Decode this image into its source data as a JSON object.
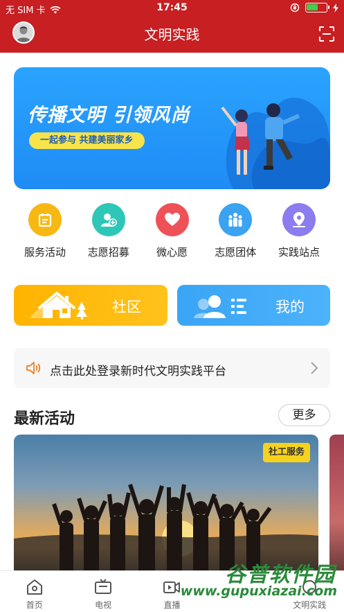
{
  "status": {
    "carrier": "无 SIM 卡",
    "time": "17:45",
    "battery_level": 0.6
  },
  "header": {
    "title": "文明实践"
  },
  "banner": {
    "title": "传播文明 引领风尚",
    "subtitle": "一起参与 共建美丽家乡"
  },
  "quick_actions": [
    {
      "label": "服务活动",
      "icon": "calendar-icon",
      "color": "#f8b814"
    },
    {
      "label": "志愿招募",
      "icon": "user-plus-icon",
      "color": "#2ec7b7"
    },
    {
      "label": "微心愿",
      "icon": "heart-icon",
      "color": "#ee5158"
    },
    {
      "label": "志愿团体",
      "icon": "group-icon",
      "color": "#3aa3f2"
    },
    {
      "label": "实践站点",
      "icon": "location-pin-icon",
      "color": "#8b7cf0"
    }
  ],
  "cards": {
    "community": "社区",
    "mine": "我的"
  },
  "notice": {
    "text": "点击此处登录新时代文明实践平台"
  },
  "latest": {
    "title": "最新活动",
    "more": "更多",
    "badge": "社工服务"
  },
  "tabs": [
    {
      "label": "首页",
      "icon": "home-icon"
    },
    {
      "label": "电视",
      "icon": "tv-icon"
    },
    {
      "label": "直播",
      "icon": "video-icon"
    },
    {
      "label": "",
      "icon": "blank"
    },
    {
      "label": "文明实践",
      "icon": "practice-icon"
    }
  ],
  "watermark": {
    "main": "谷普软件园",
    "url": "www.gupuxiazai.com"
  }
}
